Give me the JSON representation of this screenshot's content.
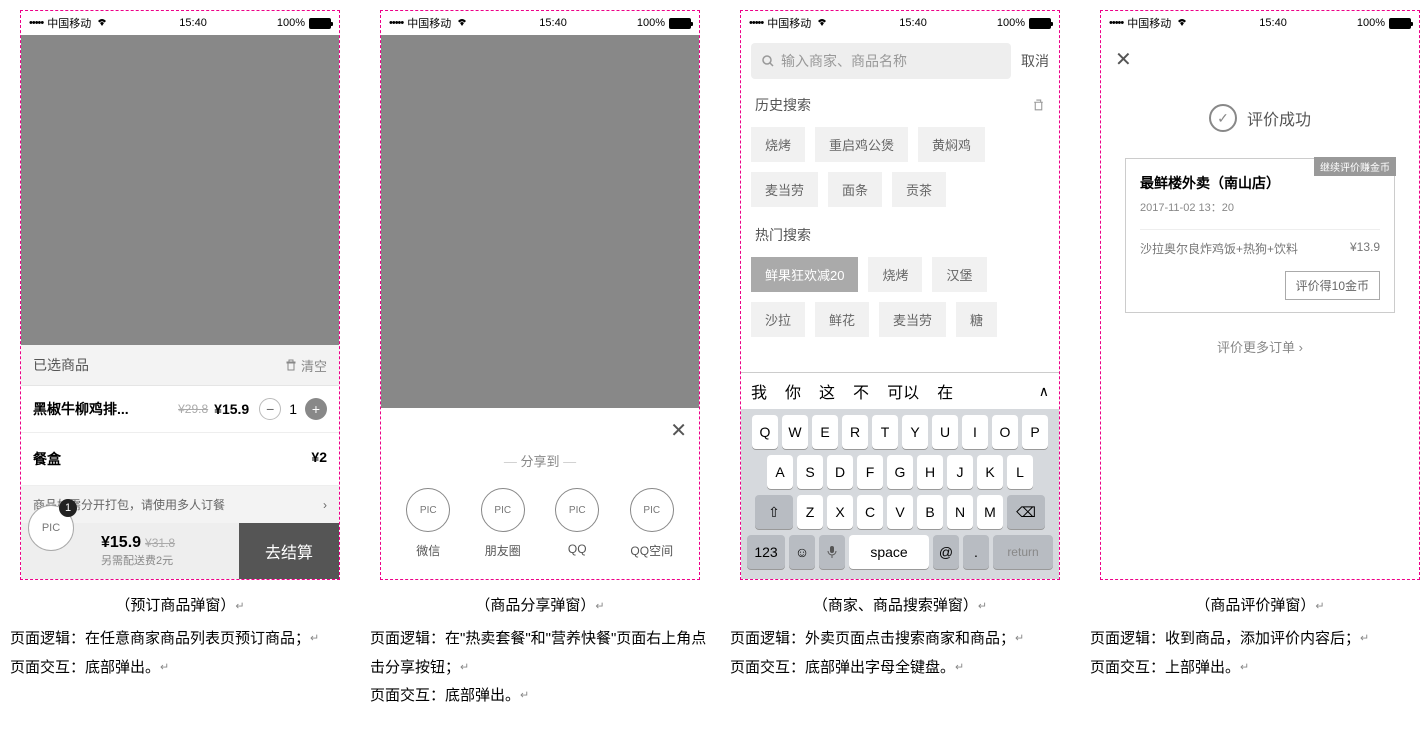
{
  "statusbar": {
    "carrier": "中国移动",
    "time": "15:40",
    "battery": "100%"
  },
  "screen1": {
    "selected_title": "已选商品",
    "clear": "清空",
    "item_name": "黑椒牛柳鸡排...",
    "item_orig": "¥29.8",
    "item_price": "¥15.9",
    "item_qty": "1",
    "box_label": "餐盒",
    "box_price": "¥2",
    "tip": "商品如需分开打包，请使用多人订餐",
    "tip_arrow": "›",
    "cart_pic": "PIC",
    "cart_badge": "1",
    "total": "¥15.9",
    "total_orig": "¥31.8",
    "delivery_note": "另需配送费2元",
    "checkout": "去结算",
    "caption": "（预订商品弹窗）",
    "desc1": "页面逻辑：在任意商家商品列表页预订商品；",
    "desc2": "页面交互：底部弹出。"
  },
  "screen2": {
    "share_title": "分享到",
    "pic": "PIC",
    "opt1": "微信",
    "opt2": "朋友圈",
    "opt3": "QQ",
    "opt4": "QQ空间",
    "caption": "（商品分享弹窗）",
    "desc1": "页面逻辑：在\"热卖套餐\"和\"营养快餐\"页面右上角点击分享按钮；",
    "desc2": "页面交互：底部弹出。"
  },
  "screen3": {
    "placeholder": "输入商家、商品名称",
    "cancel": "取消",
    "history_title": "历史搜索",
    "h1": "烧烤",
    "h2": "重启鸡公煲",
    "h3": "黄焖鸡",
    "h4": "麦当劳",
    "h5": "面条",
    "h6": "贡茶",
    "hot_title": "热门搜索",
    "t1": "鲜果狂欢减20",
    "t2": "烧烤",
    "t3": "汉堡",
    "t4": "沙拉",
    "t5": "鲜花",
    "t6": "麦当劳",
    "t7": "糖",
    "cand1": "我",
    "cand2": "你",
    "cand3": "这",
    "cand4": "不",
    "cand5": "可以",
    "cand6": "在",
    "row1": [
      "Q",
      "W",
      "E",
      "R",
      "T",
      "Y",
      "U",
      "I",
      "O",
      "P"
    ],
    "row2": [
      "A",
      "S",
      "D",
      "F",
      "G",
      "H",
      "J",
      "K",
      "L"
    ],
    "row3": [
      "Z",
      "X",
      "C",
      "V",
      "B",
      "N",
      "M"
    ],
    "num": "123",
    "space": "space",
    "return": "return",
    "caption": "（商家、商品搜索弹窗）",
    "desc1": "页面逻辑：外卖页面点击搜索商家和商品；",
    "desc2": "页面交互：底部弹出字母全键盘。"
  },
  "screen4": {
    "success": "评价成功",
    "flag": "继续评价赚金币",
    "shop": "最鲜楼外卖（南山店）",
    "time": "2017-11-02 13：20",
    "goods": "沙拉奥尔良炸鸡饭+热狗+饮料",
    "price": "¥13.9",
    "btn": "评价得10金币",
    "more": "评价更多订单 ›",
    "caption": "（商品评价弹窗）",
    "desc1": "页面逻辑：收到商品，添加评价内容后；",
    "desc2": "页面交互：上部弹出。"
  }
}
